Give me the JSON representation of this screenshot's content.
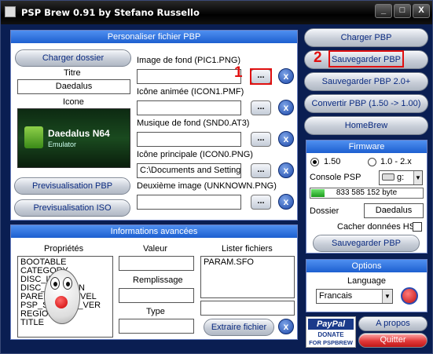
{
  "window": {
    "title": "PSP Brew 0.91   by Stefano Russello",
    "btn_min": "_",
    "btn_max": "□",
    "btn_close": "X"
  },
  "personaliser": {
    "header": "Personaliser fichier PBP",
    "charger_dossier": "Charger dossier",
    "titre_label": "Titre",
    "titre_value": "Daedalus",
    "icone_label": "Icone",
    "icon_title": "Daedalus N64",
    "icon_subtitle": "Emulator",
    "previsualisation_pbp": "Previsualisation PBP",
    "previsualisation_iso": "Previsualisation ISO",
    "fields": [
      {
        "label": "Image de fond (PIC1.PNG)",
        "value": ""
      },
      {
        "label": "Icône animée (ICON1.PMF)",
        "value": ""
      },
      {
        "label": "Musique de fond (SND0.AT3)",
        "value": ""
      },
      {
        "label": "Icône principale (ICON0.PNG)",
        "value": "C:\\Documents and Setting"
      },
      {
        "label": "Deuxième image (UNKNOWN.PNG)",
        "value": ""
      }
    ],
    "browse": "...",
    "clear": "x"
  },
  "informations": {
    "header": "Informations avancées",
    "proprietes_label": "Propriétés",
    "valeur_label": "Valeur",
    "remplissage_label": "Remplissage",
    "type_label": "Type",
    "lister_label": "Lister fichiers",
    "properties": [
      "BOOTABLE",
      "CATEGORY",
      "DISC_ID",
      "DISC_VERSION",
      "PARENTAL_LEVEL",
      "PSP_SYSTEM_VER",
      "REGION",
      "TITLE"
    ],
    "files": [
      "PARAM.SFO"
    ],
    "extraire": "Extraire fichier"
  },
  "actions": {
    "charger_pbp": "Charger PBP",
    "sauvegarder_pbp": "Sauvegarder PBP",
    "sauvegarder_pbp_20": "Sauvegarder PBP 2.0+",
    "convertir": "Convertir PBP (1.50 -> 1.00)",
    "homebrew": "HomeBrew"
  },
  "firmware": {
    "header": "Firmware",
    "opt1": "1.50",
    "opt2": "1.0 - 2.x",
    "selected": "1.50",
    "console_label": "Console PSP",
    "drive": "g:",
    "free_space": "833 585 152 byte",
    "free_fraction": 0.12,
    "dossier_label": "Dossier",
    "dossier_value": "Daedalus",
    "cacher_label": "Cacher données HS",
    "sauvegarder": "Sauvegarder PBP"
  },
  "options": {
    "header": "Options",
    "language_label": "Language",
    "language_value": "Francais"
  },
  "footer": {
    "paypal": "PayPal",
    "donate": "DONATE",
    "for": "FOR PSPBREW",
    "apropos": "A propos",
    "quitter": "Quitter"
  },
  "annotations": {
    "marker1": "1",
    "marker2": "2"
  },
  "colors": {
    "accent_red": "#e01010",
    "header_blue": "#1d5fd0",
    "bg_navy": "#0a1e52"
  }
}
